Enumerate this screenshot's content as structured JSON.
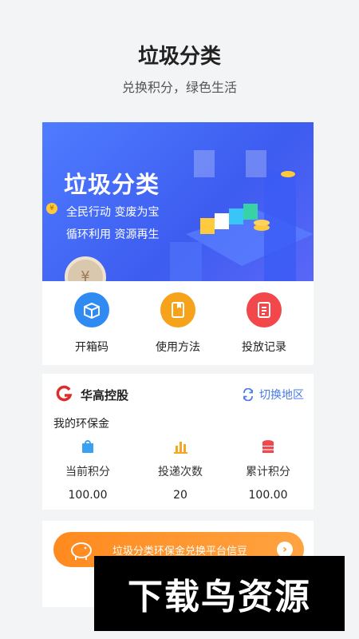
{
  "header": {
    "title": "垃圾分类",
    "subtitle": "兑换积分，绿色生活"
  },
  "banner": {
    "title": "垃圾分类",
    "line1": "全民行动 变废为宝",
    "line2": "循环利用 资源再生",
    "coin_symbol": "¥"
  },
  "quick_actions": [
    {
      "label": "开箱码",
      "color": "#2f8bf2",
      "icon": "box-icon"
    },
    {
      "label": "使用方法",
      "color": "#f7a21b",
      "icon": "book-icon"
    },
    {
      "label": "投放记录",
      "color": "#f2474b",
      "icon": "record-icon"
    }
  ],
  "card": {
    "brand": "华高控股",
    "switch_label": "切换地区",
    "fund_title": "我的环保金",
    "stats": [
      {
        "label": "当前积分",
        "value": "100.00",
        "icon": "bag-icon",
        "color": "#3aa0f0"
      },
      {
        "label": "投递次数",
        "value": "20",
        "icon": "bar-chart-icon",
        "color": "#f5a623"
      },
      {
        "label": "累计积分",
        "value": "100.00",
        "icon": "coin-stack-icon",
        "color": "#ec4a4f"
      }
    ]
  },
  "promo": {
    "text": "垃圾分类环保金兑换平台信豆",
    "arrow": "›"
  },
  "watermark": "下载鸟资源"
}
